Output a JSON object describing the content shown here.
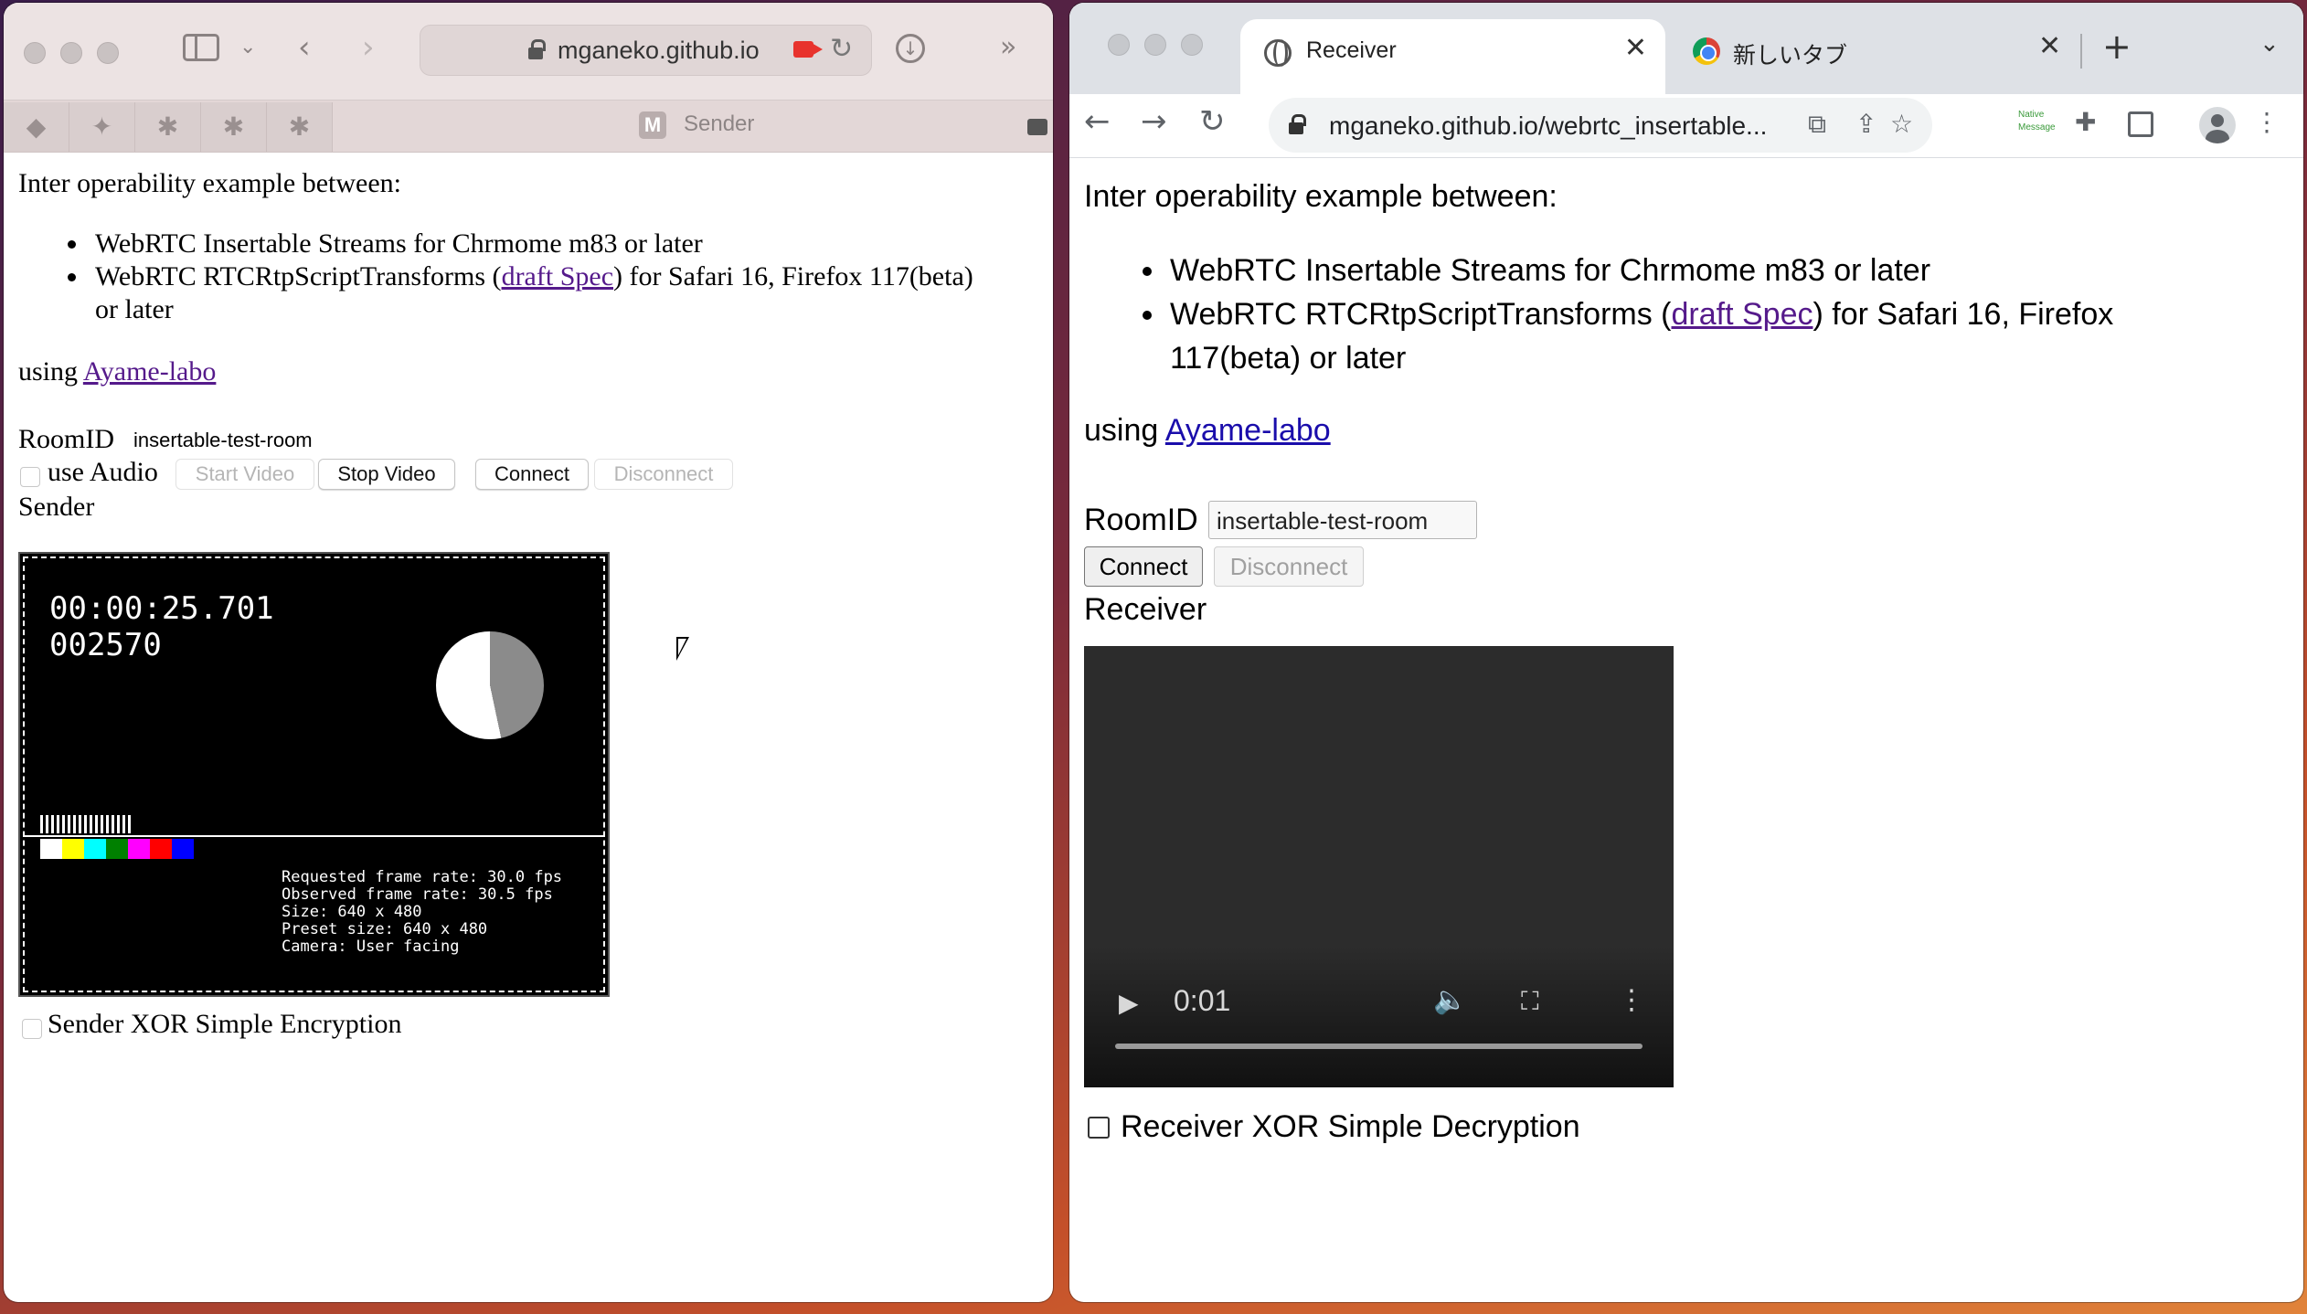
{
  "safari": {
    "url": "mganeko.github.io",
    "tab_title": "Sender",
    "tab_badge": "M",
    "favorites": [
      "bookmark-a",
      "twitter",
      "slack",
      "slack",
      "slack"
    ],
    "content": {
      "intro": "Inter operability example between:",
      "bullets": [
        "WebRTC Insertable Streams for Chrmome m83 or later",
        "WebRTC RTCRtpScriptTransforms ("
      ],
      "bullet2_link": "draft Spec",
      "bullet2_rest": ") for Safari 16, Firefox 117(beta)",
      "bullet2_wrap": "or later",
      "using": "using ",
      "using_link": "Ayame-labo",
      "room_label": "RoomID",
      "room_value": "insertable-test-room",
      "use_audio_label": "use Audio",
      "start_video": "Start Video",
      "stop_video": "Stop Video",
      "connect": "Connect",
      "disconnect": "Disconnect",
      "section_title": "Sender",
      "video": {
        "timecode": "00:00:25.701",
        "frame": "002570",
        "stats": [
          "Requested frame rate: 30.0 fps",
          "Observed frame rate: 30.5 fps",
          "Size: 640 x 480",
          "Preset size: 640 x 480",
          "Camera: User facing"
        ],
        "color_bars": [
          "#ffffff",
          "#ffff00",
          "#00ffff",
          "#008000",
          "#ff00ff",
          "#ff0000",
          "#0000ff"
        ]
      },
      "encryption_label": "Sender XOR Simple Encryption"
    }
  },
  "chrome": {
    "tabs": [
      {
        "title": "Receiver",
        "active": true
      },
      {
        "title": "新しいタブ",
        "active": false
      }
    ],
    "url": "mganeko.github.io/webrtc_insertable...",
    "extension_label": "Native Message",
    "content": {
      "intro": "Inter operability example between:",
      "bullet1": "WebRTC Insertable Streams for Chrmome m83 or later",
      "bullet2_a": "WebRTC RTCRtpScriptTransforms (",
      "bullet2_link": "draft Spec",
      "bullet2_rest": ") for Safari 16, Firefox",
      "bullet2_wrap": "117(beta) or later",
      "using": "using ",
      "using_link": "Ayame-labo",
      "room_label": "RoomID",
      "room_value": "insertable-test-room",
      "connect": "Connect",
      "disconnect": "Disconnect",
      "section_title": "Receiver",
      "video_time": "0:01",
      "decryption_label": "Receiver XOR Simple Decryption"
    }
  },
  "colors": {
    "link": "#1a0dab",
    "visited_link": "#551a8b",
    "camera_indicator": "#e8332d"
  }
}
